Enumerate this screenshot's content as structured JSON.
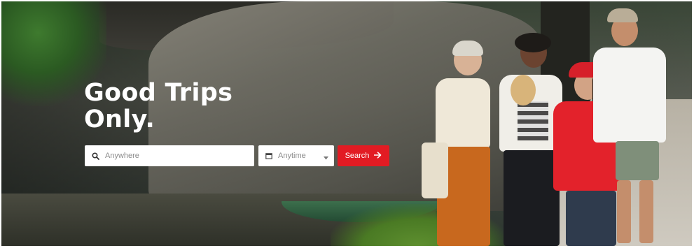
{
  "hero": {
    "headline_line1": "Good Trips",
    "headline_line2": "Only."
  },
  "search": {
    "destination_placeholder": "Anywhere",
    "date_value": "Anytime",
    "button_label": "Search",
    "destination_icon": "search-icon",
    "date_icon": "calendar-icon",
    "button_icon": "arrow-right-icon",
    "accent_color": "#e21b23"
  }
}
